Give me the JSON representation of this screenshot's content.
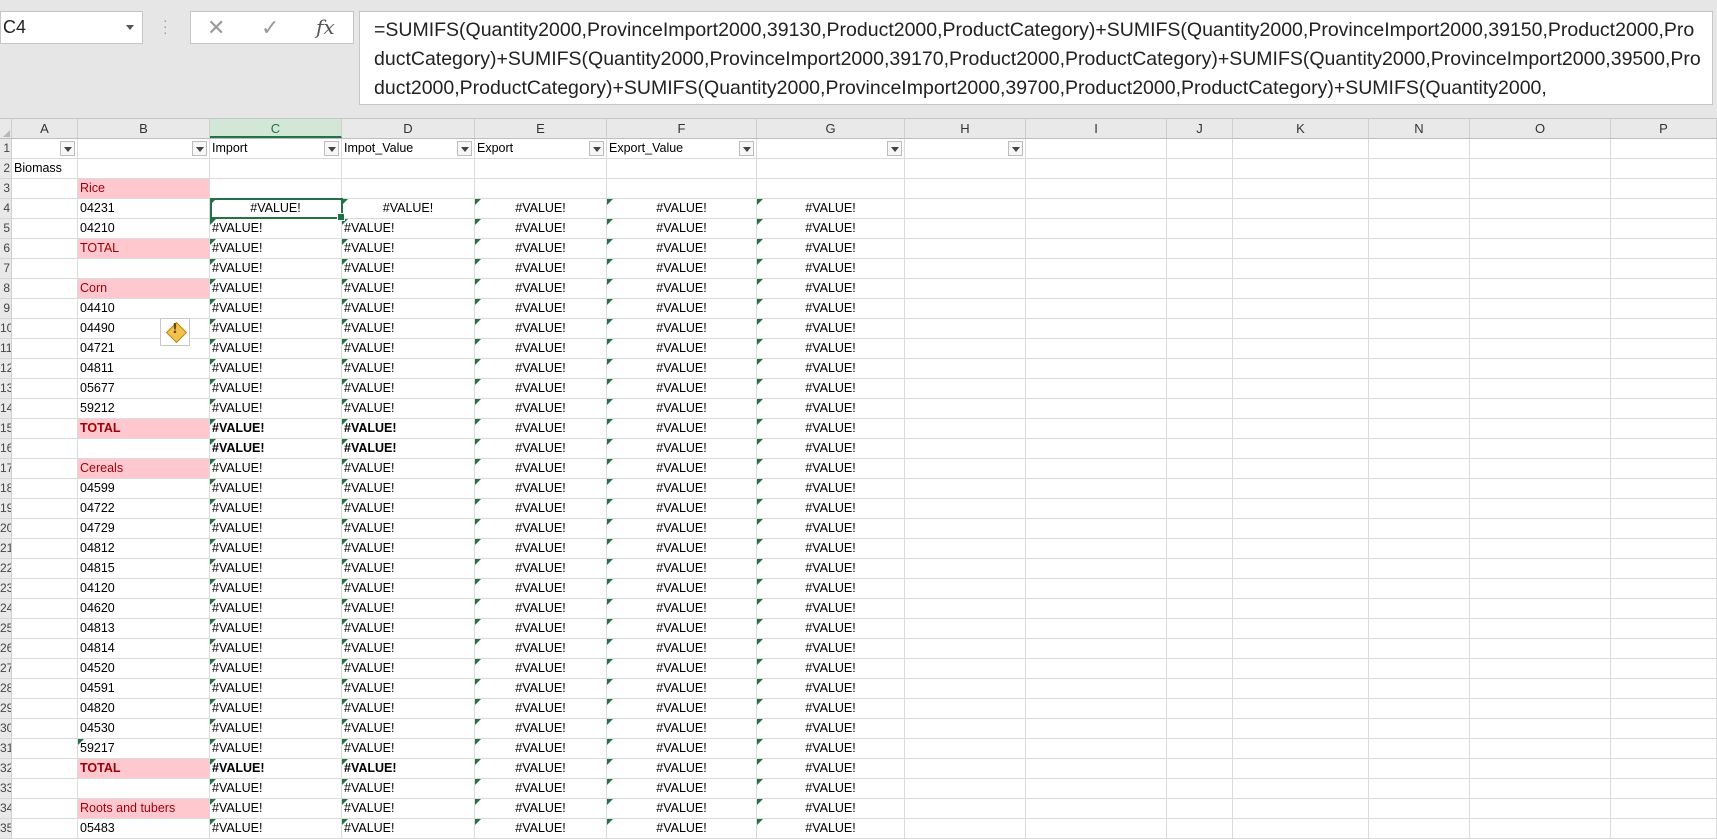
{
  "name_box": "C4",
  "formula": "=SUMIFS(Quantity2000,ProvinceImport2000,39130,Product2000,ProductCategory)+SUMIFS(Quantity2000,ProvinceImport2000,39150,Product2000,ProductCategory)+SUMIFS(Quantity2000,ProvinceImport2000,39170,Product2000,ProductCategory)+SUMIFS(Quantity2000,ProvinceImport2000,39500,Product2000,ProductCategory)+SUMIFS(Quantity2000,ProvinceImport2000,39700,Product2000,ProductCategory)+SUMIFS(Quantity2000,",
  "formula_buttons": {
    "cancel": "✕",
    "enter": "✓",
    "fx": "fx"
  },
  "columns": [
    "A",
    "B",
    "C",
    "D",
    "E",
    "F",
    "G",
    "H",
    "I",
    "J",
    "K",
    "N",
    "O",
    "P"
  ],
  "selected_column": "C",
  "header_row": {
    "C": "Import",
    "D": "Impot_Value",
    "E": "Export",
    "F": "Export_Value"
  },
  "error": "#VALUE!",
  "rows": [
    {
      "n": "1",
      "a": "",
      "b": ""
    },
    {
      "n": "2",
      "a": "Biomass",
      "b": ""
    },
    {
      "n": "3",
      "a": "",
      "b": "Rice",
      "style": "pink",
      "empty": true
    },
    {
      "n": "4",
      "a": "",
      "b": "04231",
      "active": true
    },
    {
      "n": "5",
      "a": "",
      "b": "04210"
    },
    {
      "n": "6",
      "a": "",
      "b": "TOTAL",
      "style": "pink"
    },
    {
      "n": "7",
      "a": "",
      "b": ""
    },
    {
      "n": "8",
      "a": "",
      "b": "Corn",
      "style": "pink"
    },
    {
      "n": "9",
      "a": "",
      "b": "04410"
    },
    {
      "n": "10",
      "a": "",
      "b": "04490"
    },
    {
      "n": "11",
      "a": "",
      "b": "04721"
    },
    {
      "n": "12",
      "a": "",
      "b": "04811"
    },
    {
      "n": "13",
      "a": "",
      "b": "05677"
    },
    {
      "n": "14",
      "a": "",
      "b": "59212"
    },
    {
      "n": "15",
      "a": "",
      "b": "TOTAL",
      "style": "pinkb",
      "boldvals": true
    },
    {
      "n": "16",
      "a": "",
      "b": "",
      "boldvals": true
    },
    {
      "n": "17",
      "a": "",
      "b": "Cereals",
      "style": "pink"
    },
    {
      "n": "18",
      "a": "",
      "b": "04599"
    },
    {
      "n": "19",
      "a": "",
      "b": "04722"
    },
    {
      "n": "20",
      "a": "",
      "b": "04729"
    },
    {
      "n": "21",
      "a": "",
      "b": "04812"
    },
    {
      "n": "22",
      "a": "",
      "b": "04815"
    },
    {
      "n": "23",
      "a": "",
      "b": "04120"
    },
    {
      "n": "24",
      "a": "",
      "b": "04620"
    },
    {
      "n": "25",
      "a": "",
      "b": "04813"
    },
    {
      "n": "26",
      "a": "",
      "b": "04814"
    },
    {
      "n": "27",
      "a": "",
      "b": "04520"
    },
    {
      "n": "28",
      "a": "",
      "b": "04591"
    },
    {
      "n": "29",
      "a": "",
      "b": "04820"
    },
    {
      "n": "30",
      "a": "",
      "b": "04530"
    },
    {
      "n": "31",
      "a": "",
      "b": "59217",
      "btri": true
    },
    {
      "n": "32",
      "a": "",
      "b": "TOTAL",
      "style": "pinkb",
      "boldvals": true
    },
    {
      "n": "33",
      "a": "",
      "b": ""
    },
    {
      "n": "34",
      "a": "",
      "b": "Roots and tubers",
      "style": "pink"
    },
    {
      "n": "35",
      "a": "",
      "b": "05483"
    }
  ]
}
